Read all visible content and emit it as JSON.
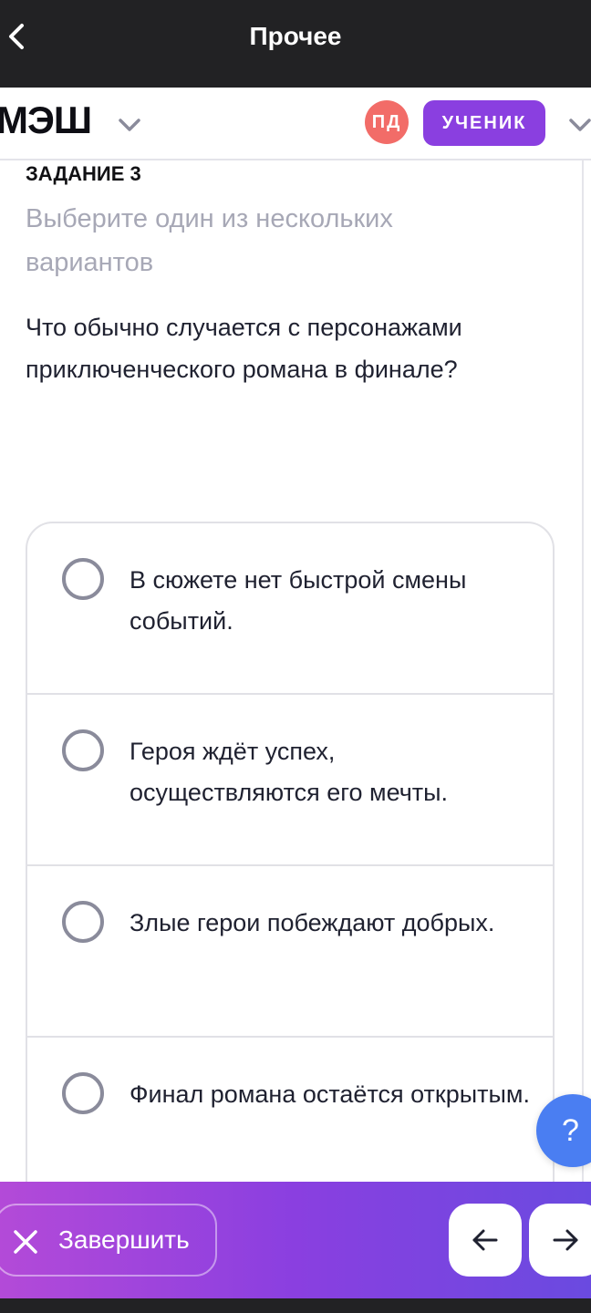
{
  "header": {
    "title": "Прочее"
  },
  "appbar": {
    "logo": "МЭШ",
    "avatar_initials": "ПД",
    "role_label": "УЧЕНИК"
  },
  "task": {
    "label": "ЗАДАНИЕ 3",
    "hint": "Выберите один из нескольких вариантов",
    "question": "Что обычно случается с персонажами приключенческого романа в финале?",
    "options": [
      {
        "text": "В сюжете нет быстрой смены событий."
      },
      {
        "text": "Героя ждёт успех, осуществляются его мечты."
      },
      {
        "text": "Злые герои побеждают добрых."
      },
      {
        "text": "Финал романа остаётся открытым."
      }
    ]
  },
  "help": {
    "label": "?"
  },
  "footer": {
    "finish_label": "Завершить"
  },
  "colors": {
    "accent": "#8a3fe0",
    "avatar": "#f26c68",
    "help": "#4a7ef2",
    "topbar": "#222224"
  },
  "icons": {
    "back": "chevron-left-icon",
    "dropdown": "chevron-down-icon",
    "close": "close-icon",
    "prev": "arrow-left-icon",
    "next": "arrow-right-icon"
  }
}
